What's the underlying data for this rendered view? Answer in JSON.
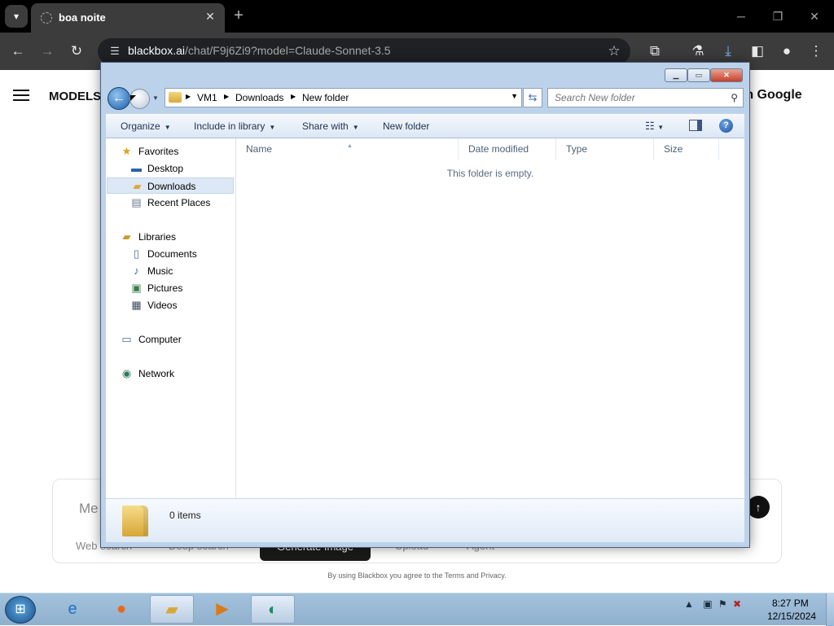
{
  "browser": {
    "tab_title": "boa noite",
    "url_host": "blackbox.ai",
    "url_path": "/chat/F9j6Zi9?model=Claude-Sonnet-3.5"
  },
  "page": {
    "models_label": "MODELS",
    "google_signin": "th Google",
    "chat_placeholder": "Me",
    "chips": [
      "Web search",
      "Deep search",
      "Generate Image",
      "Upload",
      "Agent"
    ],
    "terms": "By using Blackbox you agree to the Terms and Privacy."
  },
  "explorer": {
    "breadcrumb": [
      "VM1",
      "Downloads",
      "New folder"
    ],
    "search_placeholder": "Search New folder",
    "commands": {
      "organize": "Organize",
      "include_in_library": "Include in library",
      "share_with": "Share with",
      "new_folder": "New folder"
    },
    "nav": {
      "favorites": "Favorites",
      "desktop": "Desktop",
      "downloads": "Downloads",
      "recent_places": "Recent Places",
      "libraries": "Libraries",
      "documents": "Documents",
      "music": "Music",
      "pictures": "Pictures",
      "videos": "Videos",
      "computer": "Computer",
      "network": "Network"
    },
    "columns": {
      "name": "Name",
      "date_modified": "Date modified",
      "type": "Type",
      "size": "Size"
    },
    "empty_message": "This folder is empty.",
    "status_items": "0 items"
  },
  "taskbar": {
    "clock_time": "8:27 PM",
    "clock_date": "12/15/2024"
  },
  "colors": {
    "chrome_dark": "#3c3c3c",
    "explorer_frame": "#bcd2ea",
    "selection": "#dde8f6",
    "taskbar": "#9fbedb"
  }
}
